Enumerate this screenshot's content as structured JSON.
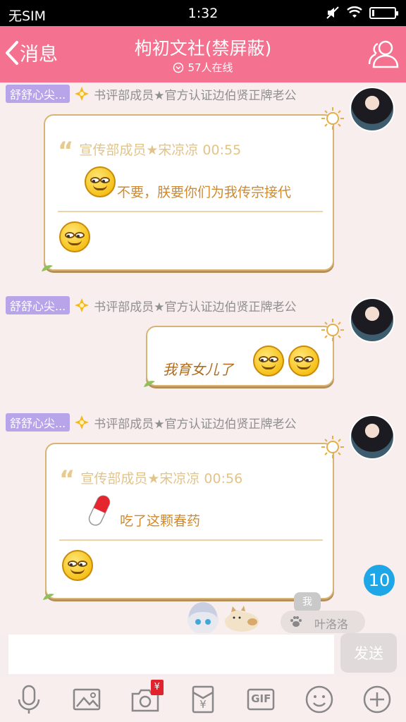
{
  "status_bar": {
    "carrier": "无SIM",
    "time": "1:32"
  },
  "header": {
    "back_label": "消息",
    "title": "枸初文社(禁屏蔽)",
    "online_text": "57人在线"
  },
  "messages": [
    {
      "sender_nick": "舒舒心尖...",
      "sender_role": "书评部成员★官方认证边伯贤正牌老公",
      "quote_header": "宣传部成员★宋凉凉 00:55",
      "quote_text": "不要，朕要你们为我传宗接代"
    },
    {
      "sender_nick": "舒舒心尖...",
      "sender_role": "书评部成员★官方认证边伯贤正牌老公",
      "text": "我育女儿了"
    },
    {
      "sender_nick": "舒舒心尖...",
      "sender_role": "书评部成员★官方认证边伯贤正牌老公",
      "quote_header": "宣传部成员★宋凉凉 00:56",
      "quote_text": "吃了这颗春药"
    }
  ],
  "new_message_badge": "10",
  "me_tag": "我",
  "viewer_name": "叶洛洛",
  "input": {
    "placeholder": "",
    "send_label": "发送"
  },
  "toolbar": {
    "icons": [
      "microphone-icon",
      "image-icon",
      "camera-icon",
      "red-packet-icon",
      "gif-icon",
      "emoji-icon",
      "plus-icon"
    ],
    "gif_label": "GIF",
    "camera_badge": "¥",
    "red_packet_symbol": "¥"
  },
  "colors": {
    "header": "#f4718f",
    "nick_badge": "#b8a4e8",
    "bubble_border": "#d7b474",
    "badge": "#1ea6e6"
  }
}
